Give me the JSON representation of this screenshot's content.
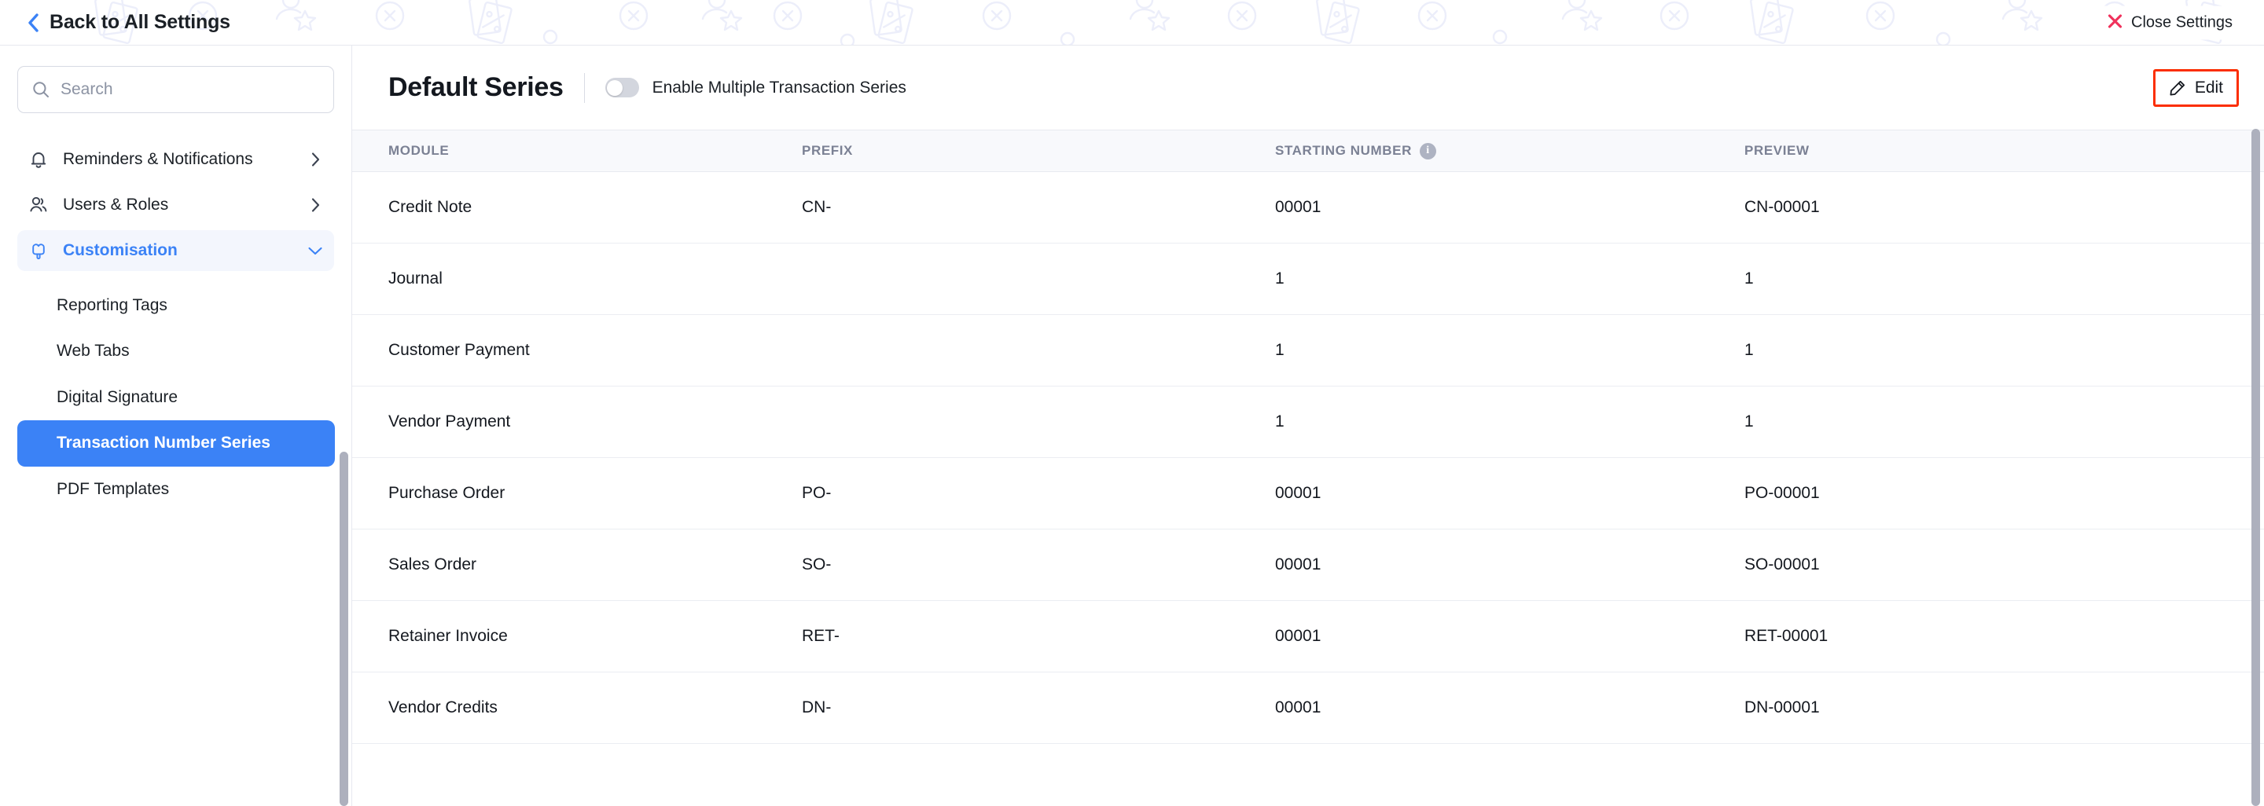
{
  "topbar": {
    "back_label": "Back to All Settings",
    "back_icon": "chevron-left-icon",
    "close_label": "Close Settings",
    "close_icon": "close-x-icon",
    "close_icon_color": "#f0325c"
  },
  "sidebar": {
    "search": {
      "value": "",
      "placeholder": "Search",
      "icon": "search-icon"
    },
    "groups": [
      {
        "label": "Reminders & Notifications",
        "icon": "bell-icon",
        "caret": "chevron-right-icon",
        "active": false
      },
      {
        "label": "Users & Roles",
        "icon": "users-icon",
        "caret": "chevron-right-icon",
        "active": false
      },
      {
        "label": "Customisation",
        "icon": "popsicle-icon",
        "caret": "chevron-down-icon",
        "active": true
      }
    ],
    "sub_items": [
      {
        "label": "Reporting Tags",
        "selected": false
      },
      {
        "label": "Web Tabs",
        "selected": false
      },
      {
        "label": "Digital Signature",
        "selected": false
      },
      {
        "label": "Transaction Number Series",
        "selected": true
      },
      {
        "label": "PDF Templates",
        "selected": false
      }
    ],
    "accent_color": "#3b82f6"
  },
  "main": {
    "title": "Default Series",
    "toggle": {
      "label": "Enable Multiple Transaction Series",
      "on": false
    },
    "edit_button": {
      "label": "Edit",
      "icon": "pencil-icon",
      "highlight_color": "#fb2e01"
    },
    "table": {
      "columns": [
        "MODULE",
        "PREFIX",
        "STARTING NUMBER",
        "PREVIEW"
      ],
      "starting_number_info_icon": "info-icon",
      "rows": [
        {
          "module": "Credit Note",
          "prefix": "CN-",
          "starting_number": "00001",
          "preview": "CN-00001"
        },
        {
          "module": "Journal",
          "prefix": "",
          "starting_number": "1",
          "preview": "1"
        },
        {
          "module": "Customer Payment",
          "prefix": "",
          "starting_number": "1",
          "preview": "1"
        },
        {
          "module": "Vendor Payment",
          "prefix": "",
          "starting_number": "1",
          "preview": "1"
        },
        {
          "module": "Purchase Order",
          "prefix": "PO-",
          "starting_number": "00001",
          "preview": "PO-00001"
        },
        {
          "module": "Sales Order",
          "prefix": "SO-",
          "starting_number": "00001",
          "preview": "SO-00001"
        },
        {
          "module": "Retainer Invoice",
          "prefix": "RET-",
          "starting_number": "00001",
          "preview": "RET-00001"
        },
        {
          "module": "Vendor Credits",
          "prefix": "DN-",
          "starting_number": "00001",
          "preview": "DN-00001"
        }
      ]
    }
  }
}
